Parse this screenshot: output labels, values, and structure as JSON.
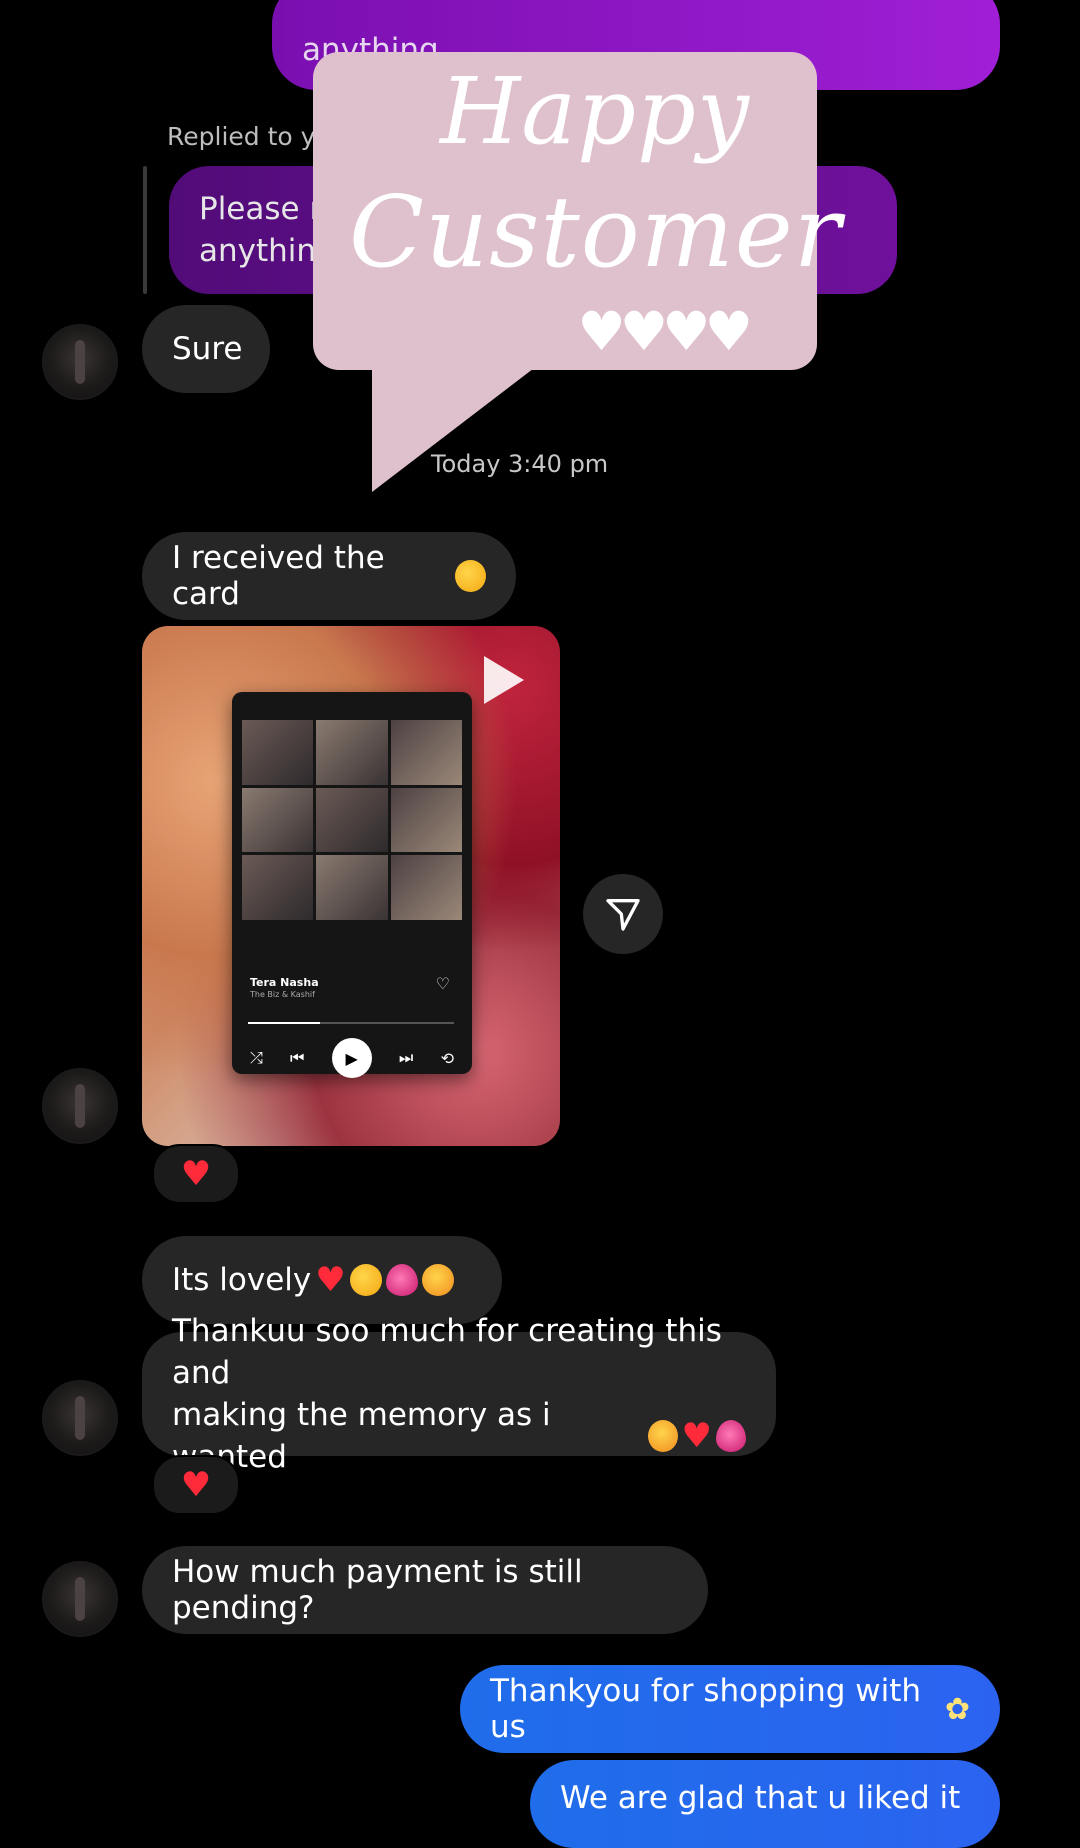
{
  "messages": {
    "top_sent": "anything",
    "replied_label": "Replied to yo",
    "quoted_line1": "Please m",
    "quoted_line2": "anything",
    "sure": "Sure",
    "timestamp": "Today 3:40 pm",
    "received": "I received the card",
    "lovely": "Its lovely",
    "thanks_line1": "Thankuu soo much for creating this and",
    "thanks_line2": "making the memory as i wanted",
    "payment": "How much payment is still pending?",
    "reply1": "Thankyou for shopping with us",
    "reply2": "We are glad that u liked it"
  },
  "sticker": {
    "line1": "Happy",
    "line2": "Customer",
    "hearts": "♥♥♥♥"
  },
  "media": {
    "song_title": "Tera Nasha",
    "song_artist": "The Biz & Kashif",
    "progress_fraction": 0.35
  },
  "reactions": [
    "♥",
    "♥"
  ],
  "icons": {
    "share": "paper-plane-icon",
    "play": "play-icon"
  },
  "colors": {
    "background": "#000000",
    "received_bubble": "#262626",
    "sent_purple": "#a01fd6",
    "sent_blue": "#2b63f0",
    "sticker": "#dfc0cd",
    "reaction_heart": "#ff2a3a"
  }
}
